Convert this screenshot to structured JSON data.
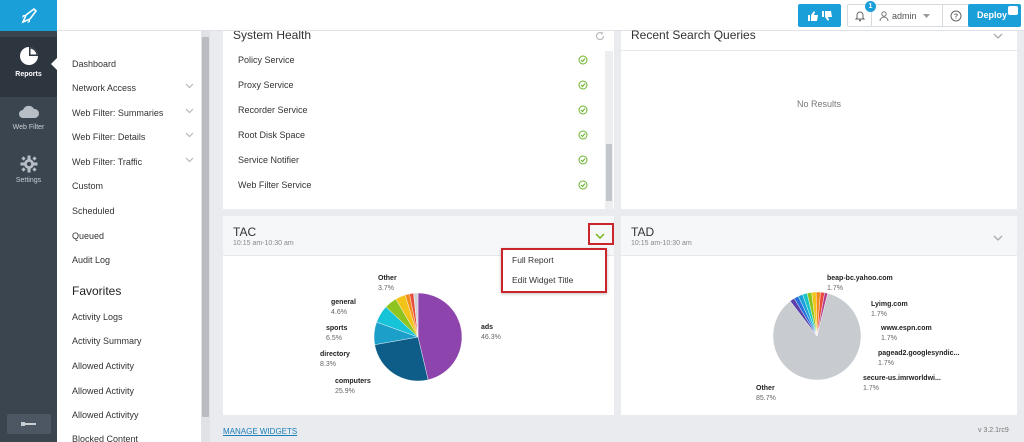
{
  "rail": {
    "items": [
      {
        "label": "Reports",
        "icon": "pie-chart-icon"
      },
      {
        "label": "Web Filter",
        "icon": "cloud-icon"
      },
      {
        "label": "Settings",
        "icon": "gear-icon"
      }
    ]
  },
  "topbar": {
    "notification_count": "1",
    "user": "admin",
    "deploy_label": "Deploy"
  },
  "subnav": {
    "items": [
      {
        "label": "Dashboard",
        "chevron": false
      },
      {
        "label": "Network Access",
        "chevron": true
      },
      {
        "label": "Web Filter: Summaries",
        "chevron": true
      },
      {
        "label": "Web Filter: Details",
        "chevron": true
      },
      {
        "label": "Web Filter: Traffic",
        "chevron": true
      },
      {
        "label": "Custom",
        "chevron": false
      },
      {
        "label": "Scheduled",
        "chevron": false
      },
      {
        "label": "Queued",
        "chevron": false
      },
      {
        "label": "Audit Log",
        "chevron": false
      }
    ],
    "favorites_heading": "Favorites",
    "favorites": [
      "Activity Logs",
      "Activity Summary",
      "Allowed Activity",
      "Allowed Activity",
      "Allowed Activityy",
      "Blocked Content"
    ]
  },
  "system_health": {
    "title": "System Health",
    "rows": [
      "Policy Service",
      "Proxy Service",
      "Recorder Service",
      "Root Disk Space",
      "Service Notifier",
      "Web Filter Service"
    ]
  },
  "recent_queries": {
    "title": "Recent Search Queries",
    "empty": "No Results"
  },
  "tac": {
    "title": "TAC",
    "time": "10:15 am-10:30 am",
    "menu": [
      "Full Report",
      "Edit Widget Title"
    ]
  },
  "tad": {
    "title": "TAD",
    "time": "10:15 am-10:30 am"
  },
  "footer": {
    "manage_widgets": "MANAGE WIDGETS",
    "version": "v 3.2.1rc9"
  },
  "chart_data": [
    {
      "type": "pie",
      "slices": [
        {
          "label": "ads",
          "value": 46.3,
          "color": "#8e44ad"
        },
        {
          "label": "computers",
          "value": 25.9,
          "color": "#0e5d88"
        },
        {
          "label": "directory",
          "value": 8.3,
          "color": "#1c9fc9"
        },
        {
          "label": "sports",
          "value": 6.5,
          "color": "#16c3d8"
        },
        {
          "label": "general",
          "value": 4.6,
          "color": "#8fc31f"
        },
        {
          "label": "Other",
          "value": 3.7,
          "color": "#f2c318"
        },
        {
          "label": "",
          "value": 1.6,
          "color": "#f28c1a"
        },
        {
          "label": "",
          "value": 1.5,
          "color": "#e74c3c"
        },
        {
          "label": "",
          "value": 1.6,
          "color": "#d0d3d6"
        }
      ],
      "labels": [
        {
          "name": "ads",
          "pct": "46.3%"
        },
        {
          "name": "computers",
          "pct": "25.9%"
        },
        {
          "name": "directory",
          "pct": "8.3%"
        },
        {
          "name": "sports",
          "pct": "6.5%"
        },
        {
          "name": "general",
          "pct": "4.6%"
        },
        {
          "name": "Other",
          "pct": "3.7%"
        }
      ]
    },
    {
      "type": "pie",
      "slices": [
        {
          "label": "Other",
          "value": 85.7,
          "color": "#c8ccd0"
        },
        {
          "label": "beap-bc.yahoo.com",
          "value": 1.7,
          "color": "#5b3fa8"
        },
        {
          "label": "Lyimg.com",
          "value": 1.7,
          "color": "#2a6fdb"
        },
        {
          "label": "www.espn.com",
          "value": 1.7,
          "color": "#1ea1d9"
        },
        {
          "label": "pagead2.googlesyndic...",
          "value": 1.7,
          "color": "#19c6c6"
        },
        {
          "label": "secure-us.imrworldwi...",
          "value": 1.7,
          "color": "#8fc31f"
        },
        {
          "label": "",
          "value": 1.6,
          "color": "#f2c318"
        },
        {
          "label": "",
          "value": 1.6,
          "color": "#f28c1a"
        },
        {
          "label": "",
          "value": 1.5,
          "color": "#e74c3c"
        },
        {
          "label": "",
          "value": 1.1,
          "color": "#b03a8e"
        }
      ],
      "labels": [
        {
          "name": "beap-bc.yahoo.com",
          "pct": "1.7%"
        },
        {
          "name": "Lyimg.com",
          "pct": "1.7%"
        },
        {
          "name": "www.espn.com",
          "pct": "1.7%"
        },
        {
          "name": "pagead2.googlesyndic...",
          "pct": "1.7%"
        },
        {
          "name": "secure-us.imrworldwi...",
          "pct": "1.7%"
        },
        {
          "name": "Other",
          "pct": "85.7%"
        }
      ]
    }
  ]
}
